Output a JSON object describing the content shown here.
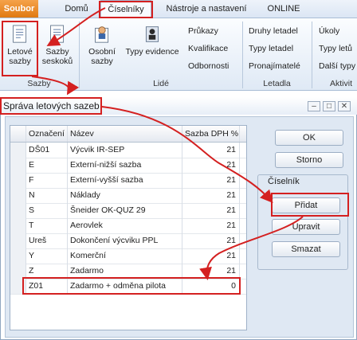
{
  "tabs": {
    "file": "Soubor",
    "items": [
      "Domů",
      "Číselníky",
      "Nástroje a nastavení",
      "ONLINE"
    ]
  },
  "ribbon": {
    "sazby_group": {
      "label": "Sazby",
      "letove": "Letové\nsazby",
      "seskoku": "Sazby\nseskoků"
    },
    "lide_group": {
      "label": "Lidé",
      "osobni": "Osobní\nsazby",
      "typy_evidence": "Typy evidence",
      "prukazy": "Průkazy",
      "kvalifikace": "Kvalifikace",
      "odbornosti": "Odbornosti"
    },
    "letadla_group": {
      "label": "Letadla",
      "druhy": "Druhy letadel",
      "typy": "Typy letadel",
      "pronajimatele": "Pronajímatelé"
    },
    "aktivity_group": {
      "label": "Aktivit",
      "ukoly": "Úkoly",
      "typy_letu": "Typy letů",
      "dalsi": "Další typy"
    }
  },
  "dialog": {
    "title": "Správa letových sazeb",
    "columns": [
      "Označení",
      "Název",
      "Sazba DPH %"
    ],
    "rows": [
      {
        "code": "DŠ01",
        "name": "Výcvik IR-SEP",
        "vat": "21"
      },
      {
        "code": "E",
        "name": "Externí-nižší sazba",
        "vat": "21"
      },
      {
        "code": "F",
        "name": "Externí-vyšší sazba",
        "vat": "21"
      },
      {
        "code": "N",
        "name": "Náklady",
        "vat": "21"
      },
      {
        "code": "S",
        "name": "Šneider OK-QUZ 29",
        "vat": "21"
      },
      {
        "code": "T",
        "name": "Aerovlek",
        "vat": "21"
      },
      {
        "code": "Ureš",
        "name": "Dokončení výcviku PPL",
        "vat": "21"
      },
      {
        "code": "Y",
        "name": "Komerční",
        "vat": "21"
      },
      {
        "code": "Z",
        "name": "Zadarmo",
        "vat": "21"
      },
      {
        "code": "Z01",
        "name": "Zadarmo + odměna pilota",
        "vat": "0"
      }
    ],
    "ok": "OK",
    "cancel": "Storno",
    "group_label": "Číselník",
    "add": "Přidat",
    "edit": "Upravit",
    "delete": "Smazat"
  },
  "colors": {
    "highlight": "#d42020",
    "file_tab": "#e07a12"
  }
}
